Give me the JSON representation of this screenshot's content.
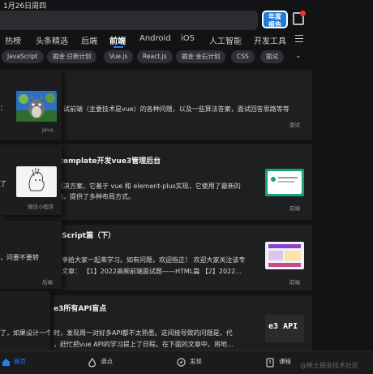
{
  "status": {
    "datetime": "1月26日周四"
  },
  "header": {
    "badge": [
      "年度",
      "报告"
    ]
  },
  "tabs": [
    "热榜",
    "头条精选",
    "后端",
    "前端",
    "Android",
    "iOS",
    "人工智能",
    "开发工具"
  ],
  "chips": [
    "JavaScript",
    "掘金·日新计划",
    "Vue.js",
    "React.js",
    "掘金·金石计划",
    "CSS",
    "面试"
  ],
  "feed": {
    "a1": {
      "desc": "试前端（主要技术是vue）的各种问题，以及一些算法答案，面试回答思路等等",
      "tag": "面试"
    },
    "o1": {
      "snip": "：",
      "tag": "Java"
    },
    "a2": {
      "title": "-template开发vue3管理后台",
      "desc1": "解决方案，它基于 vue 和 element-plus实现，它使用了最新的",
      "desc2": "端，提供了多种布局方式。",
      "tag": "前端"
    },
    "o2": {
      "snip": "了",
      "tag": "微信小程序"
    },
    "a3": {
      "title": "Script篇（下）",
      "desc1": "享给大家一起来学习。如有问题，欢迎指正！ 欢迎大家关注该专",
      "desc2": "文章： 【1】2022高频前端面试题——HTML篇 【2】2022...",
      "tag": "前端"
    },
    "o3": {
      "snip": "，问要不要转",
      "tag": "后端"
    },
    "a4": {
      "title": "e3所有API盲点",
      "desc1": "时，发现周一对好多API都不太熟悉。这间接导致的问题是，代",
      "desc2": "，赶忙把vue API的学习提上了日程。在下面的文章中，将地...",
      "thumb_text": "e3 API"
    },
    "o4": {
      "snip": "了，如果设计一个"
    }
  },
  "bottom": {
    "home": "首页",
    "hot": "沸点",
    "discover": "发现",
    "course": "课程"
  },
  "watermark": "@稀土掘金技术社区"
}
